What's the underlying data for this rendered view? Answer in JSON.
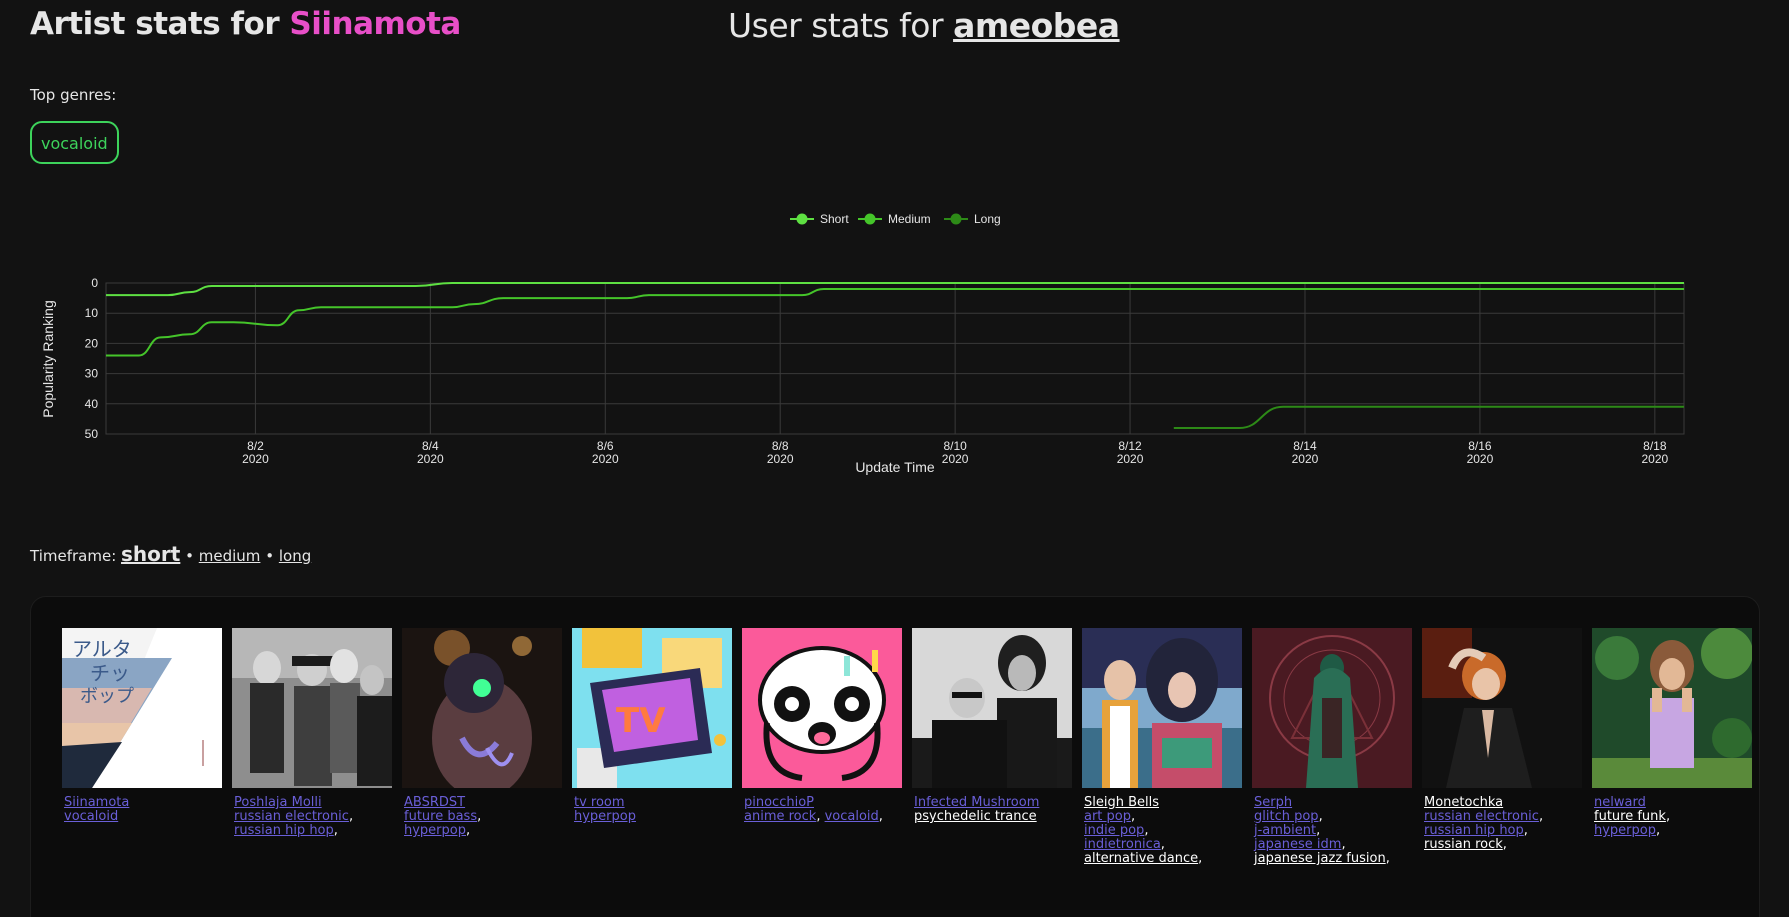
{
  "header": {
    "artist_prefix": "Artist stats for",
    "artist_name": "Siinamota",
    "user_prefix": "User stats for",
    "user_name": "ameobea"
  },
  "genres": {
    "label": "Top genres:",
    "items": [
      "vocaloid"
    ]
  },
  "timeframe": {
    "label": "Timeframe:",
    "short": "short",
    "sep1": "•",
    "medium": "medium",
    "sep2": "•",
    "long": "long",
    "active": "short"
  },
  "colors": {
    "accent_pink": "#e84fc8",
    "accent_green": "#3dd35b",
    "link_blue": "#6a5fd8",
    "series_short": "#5ee042",
    "series_medium": "#45c52a",
    "series_long": "#2d8a17"
  },
  "chart_data": {
    "type": "line",
    "xlabel": "Update Time",
    "ylabel": "Popularity Ranking",
    "y_reversed": true,
    "ylim": [
      0,
      50
    ],
    "yticks": [
      "0",
      "10",
      "20",
      "30",
      "40",
      "50"
    ],
    "xticks": [
      {
        "date": "8/2",
        "year": "2020"
      },
      {
        "date": "8/4",
        "year": "2020"
      },
      {
        "date": "8/6",
        "year": "2020"
      },
      {
        "date": "8/8",
        "year": "2020"
      },
      {
        "date": "8/10",
        "year": "2020"
      },
      {
        "date": "8/12",
        "year": "2020"
      },
      {
        "date": "8/14",
        "year": "2020"
      },
      {
        "date": "8/16",
        "year": "2020"
      },
      {
        "date": "8/18",
        "year": "2020"
      }
    ],
    "xlim": [
      "2020-07-31 07:00",
      "2020-08-18 08:00"
    ],
    "grid": true,
    "legend": "top-center",
    "series": [
      {
        "name": "Short",
        "color": "#5ee042",
        "points": [
          [
            "2020-07-31 07:00",
            4
          ],
          [
            "2020-08-01 00:00",
            4
          ],
          [
            "2020-08-01 06:00",
            3
          ],
          [
            "2020-08-01 12:00",
            1
          ],
          [
            "2020-08-01 18:00",
            1
          ],
          [
            "2020-08-02 06:00",
            1
          ],
          [
            "2020-08-03 12:00",
            1
          ],
          [
            "2020-08-03 20:00",
            1
          ],
          [
            "2020-08-04 06:00",
            0
          ],
          [
            "2020-08-18 08:00",
            0
          ]
        ]
      },
      {
        "name": "Medium",
        "color": "#45c52a",
        "points": [
          [
            "2020-07-31 07:00",
            24
          ],
          [
            "2020-07-31 16:00",
            24
          ],
          [
            "2020-07-31 22:00",
            18
          ],
          [
            "2020-08-01 06:00",
            17
          ],
          [
            "2020-08-01 12:00",
            13
          ],
          [
            "2020-08-01 18:00",
            13
          ],
          [
            "2020-08-02 06:00",
            14
          ],
          [
            "2020-08-02 12:00",
            9
          ],
          [
            "2020-08-02 18:00",
            8
          ],
          [
            "2020-08-03 12:00",
            8
          ],
          [
            "2020-08-04 06:00",
            8
          ],
          [
            "2020-08-04 12:00",
            7
          ],
          [
            "2020-08-04 20:00",
            5
          ],
          [
            "2020-08-05 12:00",
            5
          ],
          [
            "2020-08-06 06:00",
            5
          ],
          [
            "2020-08-06 12:00",
            4
          ],
          [
            "2020-08-07 12:00",
            4
          ],
          [
            "2020-08-08 06:00",
            4
          ],
          [
            "2020-08-08 12:00",
            2
          ],
          [
            "2020-08-18 08:00",
            2
          ]
        ]
      },
      {
        "name": "Long",
        "color": "#2d8a17",
        "points": [
          [
            "2020-08-12 12:00",
            48
          ],
          [
            "2020-08-13 06:00",
            48
          ],
          [
            "2020-08-13 18:00",
            41
          ],
          [
            "2020-08-18 08:00",
            41
          ]
        ]
      }
    ]
  },
  "artists": [
    {
      "name": "Siinamota",
      "name_color": "blue",
      "genres": [
        {
          "text": "vocaloid",
          "color": "blue"
        }
      ],
      "img": "siinamota"
    },
    {
      "name": "Poshlaja Molli",
      "name_color": "blue",
      "genres": [
        {
          "text": "russian electronic",
          "color": "blue"
        },
        {
          "text": "russian hip hop",
          "color": "blue"
        }
      ],
      "img": "poshlaja"
    },
    {
      "name": "ABSRDST",
      "name_color": "blue",
      "genres": [
        {
          "text": "future bass",
          "color": "blue"
        },
        {
          "text": "hyperpop",
          "color": "blue"
        }
      ],
      "img": "absrdst"
    },
    {
      "name": "tv room",
      "name_color": "blue",
      "genres": [
        {
          "text": "hyperpop",
          "color": "blue"
        }
      ],
      "img": "tvroom"
    },
    {
      "name": "pinocchioP",
      "name_color": "blue",
      "genres": [
        {
          "text": "anime rock",
          "color": "blue"
        },
        {
          "text": "vocaloid",
          "color": "blue"
        }
      ],
      "img": "pinocchio",
      "inline": true
    },
    {
      "name": "Infected Mushroom",
      "name_color": "blue",
      "genres": [
        {
          "text": "psychedelic trance",
          "color": "white"
        }
      ],
      "img": "infected"
    },
    {
      "name": "Sleigh Bells",
      "name_color": "white",
      "genres": [
        {
          "text": "art pop",
          "color": "blue"
        },
        {
          "text": "indie pop",
          "color": "blue"
        },
        {
          "text": "indietronica",
          "color": "blue"
        },
        {
          "text": "alternative dance",
          "color": "white"
        }
      ],
      "img": "sleigh",
      "breaks": [
        2,
        3
      ]
    },
    {
      "name": "Serph",
      "name_color": "blue",
      "genres": [
        {
          "text": "glitch pop",
          "color": "blue"
        },
        {
          "text": "j-ambient",
          "color": "blue"
        },
        {
          "text": "japanese idm",
          "color": "blue"
        },
        {
          "text": "japanese jazz fusion",
          "color": "white"
        }
      ],
      "img": "serph",
      "breaks": [
        2,
        3
      ]
    },
    {
      "name": "Monetochka",
      "name_color": "white",
      "genres": [
        {
          "text": "russian electronic",
          "color": "blue"
        },
        {
          "text": "russian hip hop",
          "color": "blue"
        },
        {
          "text": "russian rock",
          "color": "white"
        }
      ],
      "img": "monetochka"
    },
    {
      "name": "nelward",
      "name_color": "blue",
      "genres": [
        {
          "text": "future funk",
          "color": "white"
        },
        {
          "text": "hyperpop",
          "color": "blue"
        }
      ],
      "img": "nelward"
    }
  ]
}
